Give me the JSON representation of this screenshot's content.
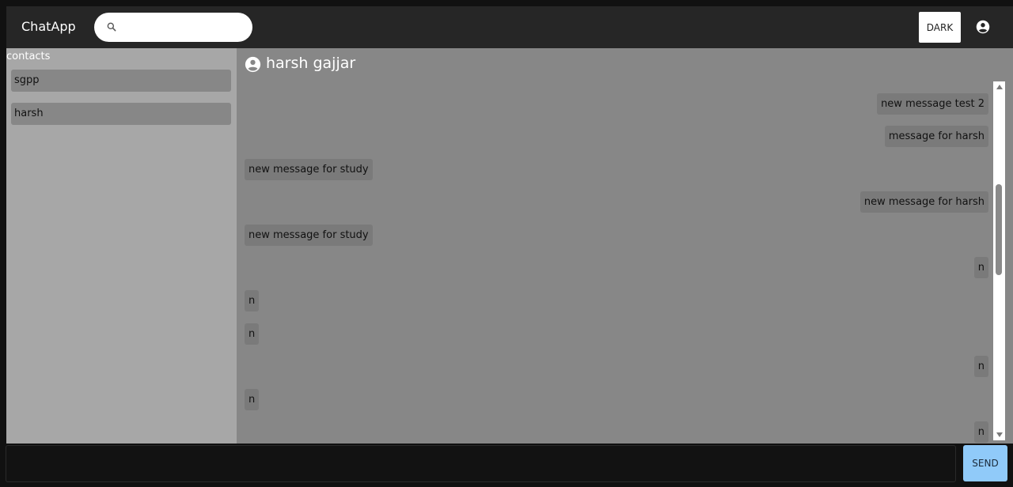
{
  "app": {
    "title": "ChatApp"
  },
  "search": {
    "placeholder": "",
    "value": ""
  },
  "toolbar": {
    "theme_button_label": "DARK"
  },
  "sidebar": {
    "heading": "contacts",
    "contacts": [
      {
        "name": "sgpp"
      },
      {
        "name": "harsh"
      }
    ]
  },
  "chat": {
    "title": "harsh gajjar",
    "messages": [
      {
        "text": "new message test 2",
        "direction": "outgoing"
      },
      {
        "text": "message for harsh",
        "direction": "outgoing"
      },
      {
        "text": "new message for study",
        "direction": "incoming"
      },
      {
        "text": "new message for harsh",
        "direction": "outgoing"
      },
      {
        "text": "new message for study",
        "direction": "incoming"
      },
      {
        "text": "n",
        "direction": "outgoing"
      },
      {
        "text": "n",
        "direction": "incoming"
      },
      {
        "text": "n",
        "direction": "incoming"
      },
      {
        "text": "n",
        "direction": "outgoing"
      },
      {
        "text": "n",
        "direction": "incoming"
      },
      {
        "text": "n",
        "direction": "outgoing"
      }
    ]
  },
  "composer": {
    "value": "",
    "placeholder": "",
    "send_label": "SEND"
  },
  "colors": {
    "appbar": "#262626",
    "sidebar": "#a7a7a7",
    "chat_bg": "#878787",
    "bubble": "#7a7a7a",
    "send_button": "#90caf9"
  },
  "icons": {
    "search": "search-icon",
    "account": "account-circle-icon",
    "chat_avatar": "account-circle-icon"
  }
}
